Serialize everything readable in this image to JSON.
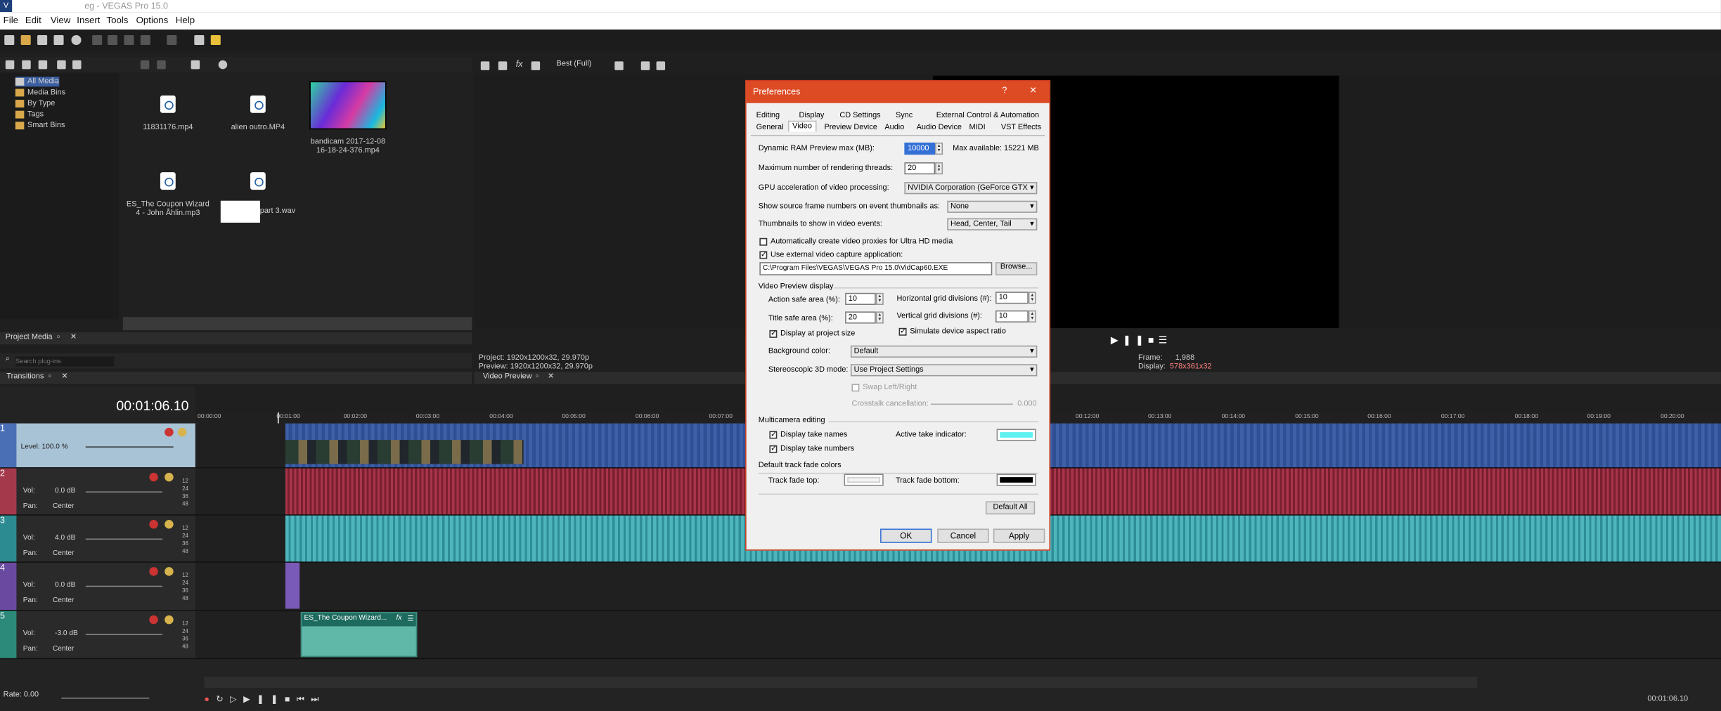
{
  "window": {
    "app_icon": "V",
    "title": "eg - VEGAS Pro 15.0"
  },
  "menu": [
    "File",
    "Edit",
    "View",
    "Insert",
    "Tools",
    "Options",
    "Help"
  ],
  "explorer": {
    "tree": [
      "All Media",
      "Media Bins",
      "By Type",
      "Tags",
      "Smart Bins"
    ],
    "files": [
      "11831176.mp4",
      "alien outro.MP4",
      "bandicam 2017-12-08 16-18-24-376.mp4",
      "ES_The Coupon Wizard 4 - John Åhlin.mp3",
      "part 3.wav"
    ]
  },
  "tabs": {
    "project_media": "Project Media",
    "transitions": "Transitions",
    "video_preview": "Video Preview",
    "search_placeholder": "Search plug-ins"
  },
  "preview": {
    "quality": "Best (Full)",
    "project": "Project:  1920x1200x32, 29.970p",
    "preview": "Preview:  1920x1200x32, 29.970p",
    "frame_label": "Frame:",
    "frame": "1,988",
    "display_label": "Display:",
    "display": "578x361x32"
  },
  "timeline": {
    "timecode": "00:01:06.10",
    "rate": "Rate: 0.00",
    "end_time": "00:01:06.10",
    "ruler": [
      "00:00:00",
      "00:01:00",
      "00:02:00",
      "00:03:00",
      "00:04:00",
      "00:05:00",
      "00:06:00",
      "00:07:00",
      "00:12:00",
      "00:13:00",
      "00:14:00",
      "00:15:00",
      "00:16:00",
      "00:17:00",
      "00:18:00",
      "00:19:00",
      "00:20:00"
    ],
    "tracks": [
      {
        "n": "1",
        "label": "Level: 100.0 %"
      },
      {
        "n": "2",
        "vol": "Vol:",
        "vol_val": "0.0 dB",
        "pan": "Pan:",
        "pan_val": "Center"
      },
      {
        "n": "3",
        "vol": "Vol:",
        "vol_val": "4.0 dB",
        "pan": "Pan:",
        "pan_val": "Center"
      },
      {
        "n": "4",
        "vol": "Vol:",
        "vol_val": "0.0 dB",
        "pan": "Pan:",
        "pan_val": "Center"
      },
      {
        "n": "5",
        "vol": "Vol:",
        "vol_val": "-3.0 dB",
        "pan": "Pan:",
        "pan_val": "Center"
      }
    ],
    "db_scale": [
      "12",
      "24",
      "36",
      "48"
    ],
    "clip_name": "ES_The Coupon Wizard...",
    "clip_fx": "fx"
  },
  "dialog": {
    "title": "Preferences",
    "help": "?",
    "close": "✕",
    "tabs_row1": [
      "Editing",
      "Display",
      "CD Settings",
      "Sync",
      "External Control & Automation"
    ],
    "tabs_row2": [
      "General",
      "Video",
      "Preview Device",
      "Audio",
      "Audio Device",
      "MIDI",
      "VST Effects"
    ],
    "ram_label": "Dynamic RAM Preview max (MB):",
    "ram_value": "10000",
    "ram_max": "Max available: 15221 MB",
    "threads_label": "Maximum number of rendering threads:",
    "threads_value": "20",
    "gpu_label": "GPU acceleration of video processing:",
    "gpu_value": "NVIDIA Corporation (GeForce GTX",
    "frame_numbers_label": "Show source frame numbers on event thumbnails as:",
    "frame_numbers_value": "None",
    "thumbs_label": "Thumbnails to show in video events:",
    "thumbs_value": "Head, Center, Tail",
    "proxies_label": "Automatically create video proxies for Ultra HD media",
    "capture_label": "Use external video capture application:",
    "capture_path": "C:\\Program Files\\VEGAS\\VEGAS Pro 15.0\\VidCap60.EXE",
    "browse": "Browse...",
    "vpd_title": "Video Preview display",
    "action_label": "Action safe area (%):",
    "action_value": "10",
    "title_label": "Title safe area (%):",
    "title_value": "20",
    "hgrid_label": "Horizontal grid divisions (#):",
    "hgrid_value": "10",
    "vgrid_label": "Vertical grid divisions (#):",
    "vgrid_value": "10",
    "project_size_label": "Display at project size",
    "simulate_label": "Simulate device aspect ratio",
    "bg_label": "Background color:",
    "bg_value": "Default",
    "stereo_label": "Stereoscopic 3D mode:",
    "stereo_value": "Use Project Settings",
    "swap_label": "Swap Left/Right",
    "crosstalk_label": "Crosstalk cancellation:",
    "crosstalk_value": "0.000",
    "multicam_title": "Multicamera editing",
    "take_names": "Display take names",
    "take_numbers": "Display take numbers",
    "active_take": "Active take indicator:",
    "fade_title": "Default track fade colors",
    "fade_top": "Track fade top:",
    "fade_bottom": "Track fade bottom:",
    "default_all": "Default All",
    "ok": "OK",
    "cancel": "Cancel",
    "apply": "Apply"
  }
}
